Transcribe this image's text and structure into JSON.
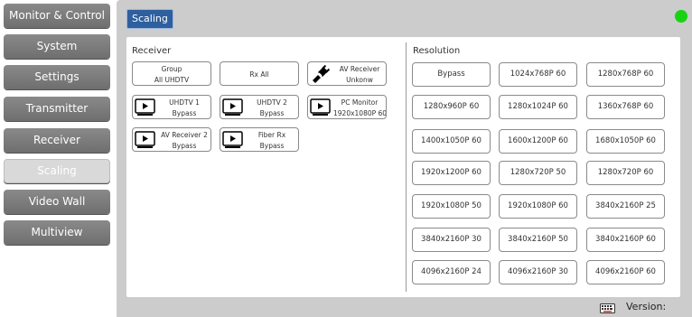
{
  "sidebar": {
    "items": [
      {
        "label": "Monitor & Control",
        "active": false
      },
      {
        "label": "System",
        "active": false
      },
      {
        "label": "Settings",
        "active": false
      },
      {
        "label": "Transmitter",
        "active": false
      },
      {
        "label": "Receiver",
        "active": false
      },
      {
        "label": "Scaling",
        "active": true
      },
      {
        "label": "Video Wall",
        "active": false
      },
      {
        "label": "Multiview",
        "active": false
      }
    ]
  },
  "header": {
    "title": "Scaling",
    "status_color": "#18d312"
  },
  "receiver": {
    "label": "Receiver",
    "buttons": [
      {
        "line1": "Group",
        "line2": "All UHDTV",
        "icon": null
      },
      {
        "line1": "Rx All",
        "line2": "",
        "icon": null
      },
      {
        "line1": "AV Receiver",
        "line2": "Unkonw",
        "icon": "plug-icon"
      },
      {
        "line1": "UHDTV 1",
        "line2": "Bypass",
        "icon": "display-icon"
      },
      {
        "line1": "UHDTV 2",
        "line2": "Bypass",
        "icon": "display-icon"
      },
      {
        "line1": "PC Monitor",
        "line2": "1920x1080P 60",
        "icon": "display-icon"
      },
      {
        "line1": "AV Receiver 2",
        "line2": "Bypass",
        "icon": "display-icon"
      },
      {
        "line1": "Fiber Rx",
        "line2": "Bypass",
        "icon": "display-icon"
      }
    ]
  },
  "resolution": {
    "label": "Resolution",
    "options": [
      "Bypass",
      "1024x768P 60",
      "1280x768P 60",
      "1280x960P 60",
      "1280x1024P 60",
      "1360x768P 60",
      "1400x1050P 60",
      "1600x1200P 60",
      "1680x1050P 60",
      "1920x1200P 60",
      "1280x720P 50",
      "1280x720P 60",
      "1920x1080P 50",
      "1920x1080P 60",
      "3840x2160P 25",
      "3840x2160P 30",
      "3840x2160P 50",
      "3840x2160P 60",
      "4096x2160P 24",
      "4096x2160P 30",
      "4096x2160P 60"
    ]
  },
  "footer": {
    "version_label": "Version:",
    "keyboard_icon": "keyboard-icon"
  }
}
